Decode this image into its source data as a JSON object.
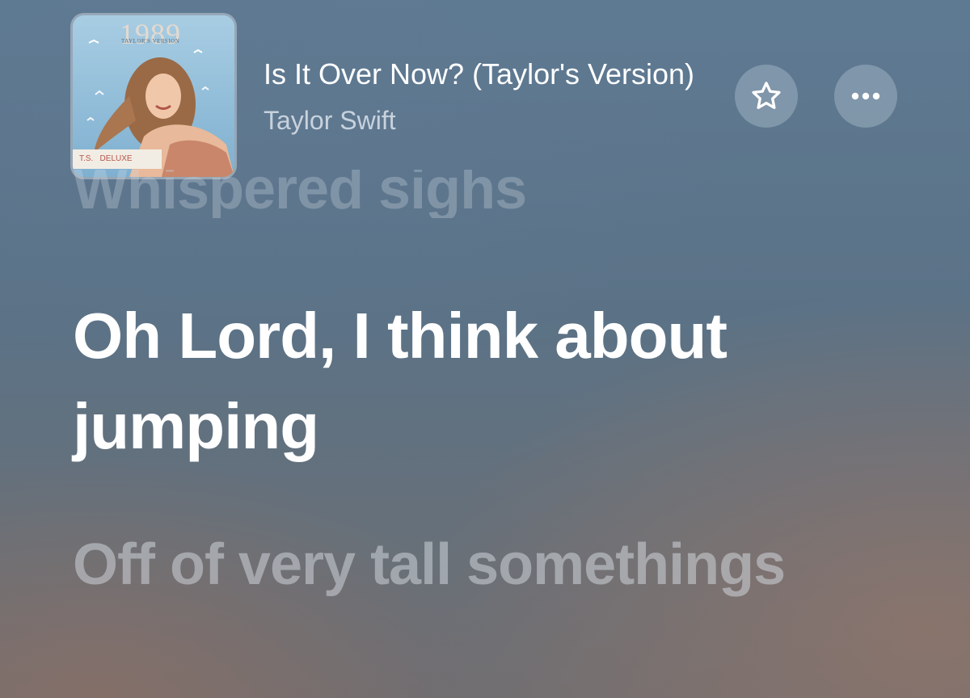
{
  "now_playing": {
    "title": "Is It Over Now? (Taylor's Version)",
    "artist": "Taylor Swift"
  },
  "album_art": {
    "album_title": "1989",
    "subtitle": "TAYLOR'S VERSION",
    "label": "T.S.   DELUXE"
  },
  "actions": {
    "favorite_icon": "star-icon",
    "more_icon": "ellipsis-icon"
  },
  "lyrics": {
    "previous": "Whispered sighs",
    "current": "Oh Lord, I think about jumping",
    "next": "Off of very tall somethings"
  }
}
